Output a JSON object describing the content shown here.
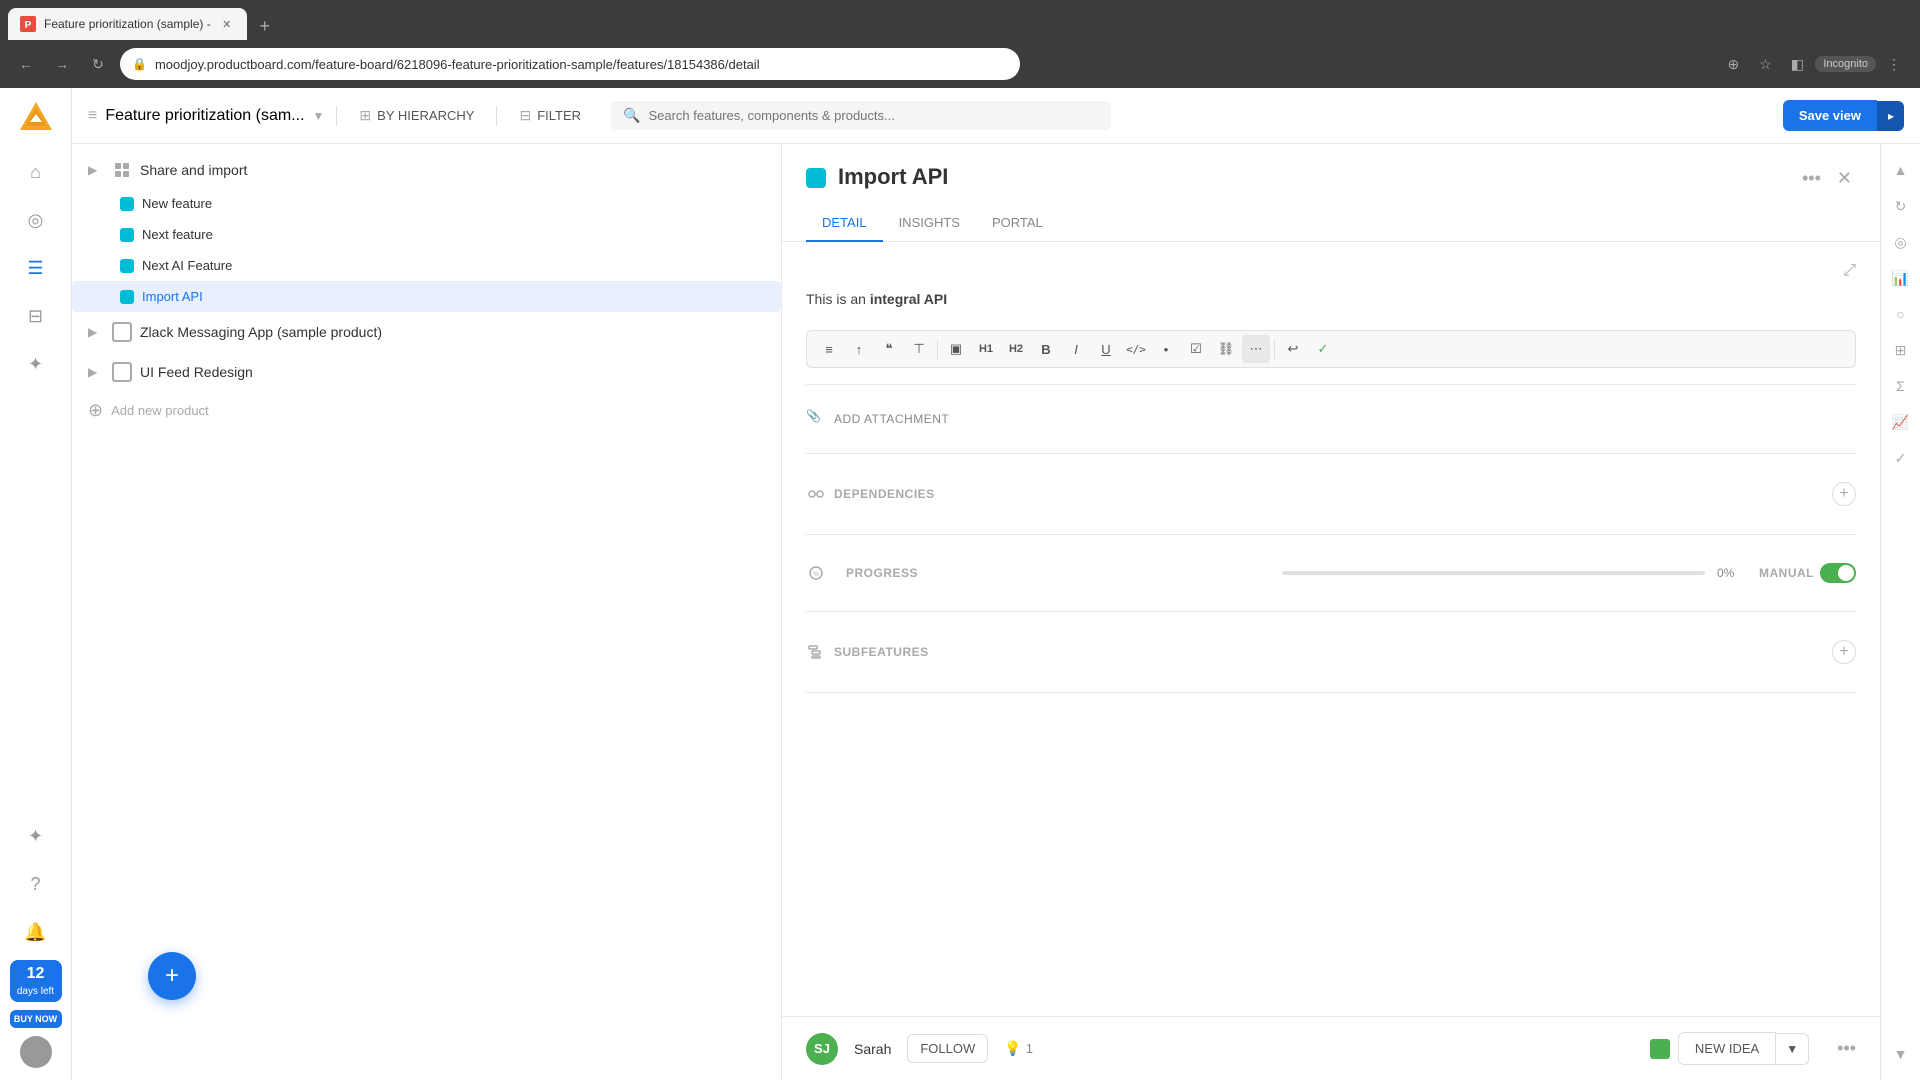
{
  "browser": {
    "tab_title": "Feature prioritization (sample) -",
    "url": "moodjoy.productboard.com/feature-board/6218096-feature-prioritization-sample/features/18154386/detail",
    "new_tab_label": "+",
    "incognito_label": "Incognito"
  },
  "topbar": {
    "view_title": "Feature prioritization (sam...",
    "hierarchy_label": "BY HIERARCHY",
    "filter_label": "FILTER",
    "search_placeholder": "Search features, components & products...",
    "save_view_label": "Save view"
  },
  "feature_list": {
    "groups": [
      {
        "name": "Share and import",
        "features": [
          {
            "name": "New feature",
            "color": "#00bcd4",
            "selected": false
          },
          {
            "name": "Next feature",
            "color": "#00bcd4",
            "selected": false
          },
          {
            "name": "Next AI Feature",
            "color": "#00bcd4",
            "selected": false
          },
          {
            "name": "Import API",
            "color": "#00bcd4",
            "selected": true
          }
        ]
      },
      {
        "name": "Zlack Messaging App (sample product)",
        "features": []
      },
      {
        "name": "UI Feed Redesign",
        "features": []
      }
    ],
    "add_product_label": "Add new product"
  },
  "detail": {
    "title": "Import API",
    "color": "#00bcd4",
    "tabs": [
      {
        "label": "DETAIL",
        "active": true
      },
      {
        "label": "INSIGHTS",
        "active": false
      },
      {
        "label": "PORTAL",
        "active": false
      }
    ],
    "description_pre": "This is an ",
    "description_bold": "integral API",
    "description_post": "",
    "sections": {
      "attachment_label": "ADD ATTACHMENT",
      "dependencies_label": "DEPENDENCIES",
      "progress_label": "PROGRESS",
      "subfeatures_label": "SUBFEATURES",
      "progress_pct": "0%",
      "manual_label": "MANUAL",
      "toggle_on": true
    }
  },
  "bottom_bar": {
    "user_initials": "SJ",
    "user_name": "Sarah",
    "follow_label": "FOLLOW",
    "idea_count": "1",
    "new_idea_label": "NEW IDEA",
    "new_idea_color": "#4caf50"
  },
  "trial": {
    "days_left": "12",
    "days_label": "days left",
    "buy_label": "BUY NOW"
  },
  "formatting": {
    "buttons": [
      "≡",
      "↑",
      "❝",
      "⊤",
      "H1",
      "H2",
      "B",
      "I",
      "U",
      "</>",
      "•",
      "☑",
      "⛓",
      "⋯",
      "↩",
      "✓"
    ]
  },
  "right_sidebar_icons": [
    "↑",
    "⊙",
    "📊",
    "☆",
    "∑",
    "📈",
    "✓"
  ]
}
